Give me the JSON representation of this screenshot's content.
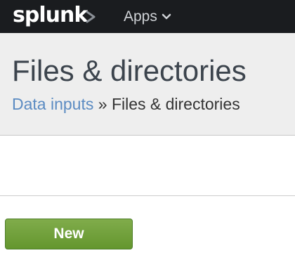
{
  "topbar": {
    "logo_text": "splunk",
    "apps_label": "Apps",
    "background": "#1a1c1f"
  },
  "header": {
    "title": "Files & directories",
    "breadcrumb": {
      "link_label": "Data inputs",
      "separator": "»",
      "current": "Files & directories"
    },
    "link_color": "#5b8bc2",
    "background": "#eeeeee"
  },
  "actions": {
    "new_label": "New",
    "new_color": "#6e9e3a"
  },
  "icons": {
    "logo_chevron": "chevron-right-icon",
    "apps_caret": "chevron-down-icon"
  }
}
